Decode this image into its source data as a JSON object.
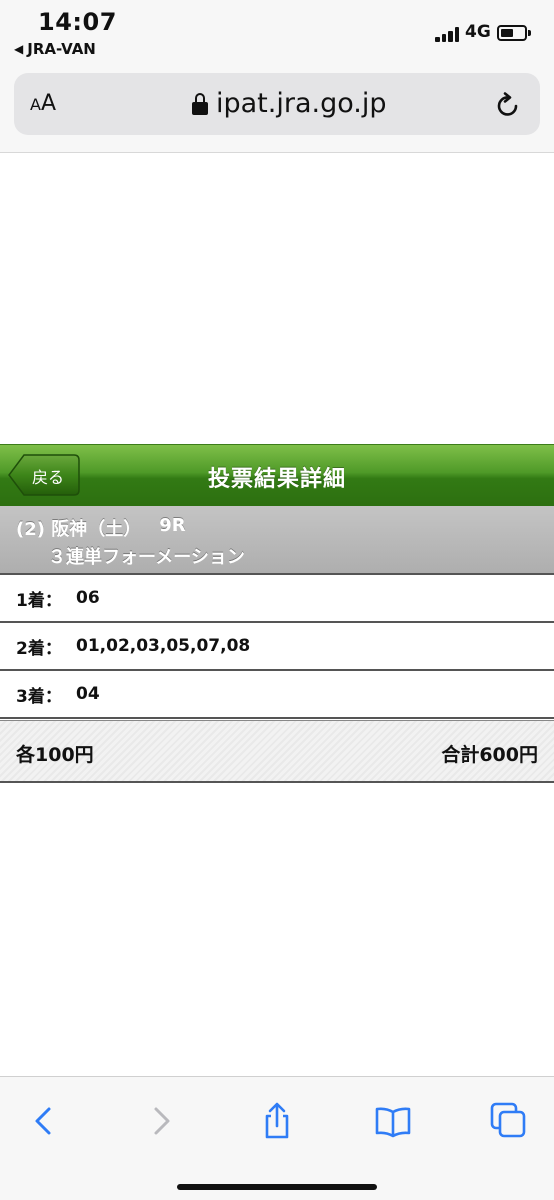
{
  "status_bar": {
    "time": "14:07",
    "back_app": "JRA-VAN",
    "network": "4G",
    "battery_level": 0.45
  },
  "browser": {
    "text_size_label": "AA",
    "url": "ipat.jra.go.jp",
    "icons": [
      "lock-icon",
      "reload-icon"
    ]
  },
  "header": {
    "back_label": "戻る",
    "title": "投票結果詳細"
  },
  "race": {
    "venue_line": "(2) 阪神（土）",
    "race_number": "9R",
    "bet_type": "３連単フォーメーション"
  },
  "selections": [
    {
      "label": "1着：",
      "value": "06"
    },
    {
      "label": "2着：",
      "value": "01,02,03,05,07,08"
    },
    {
      "label": "3着：",
      "value": "04"
    }
  ],
  "totals": {
    "each": "各100円",
    "total": "合計600円"
  },
  "toolbar": {
    "icons": [
      "back-chevron-icon",
      "forward-chevron-icon",
      "share-icon",
      "bookmarks-icon",
      "tabs-icon"
    ],
    "accent_color": "#2f7cf6",
    "disabled_color": "#b9b9bd"
  },
  "colors": {
    "header_green": "#3f8a1d",
    "race_gray": "#b8b8b8"
  }
}
